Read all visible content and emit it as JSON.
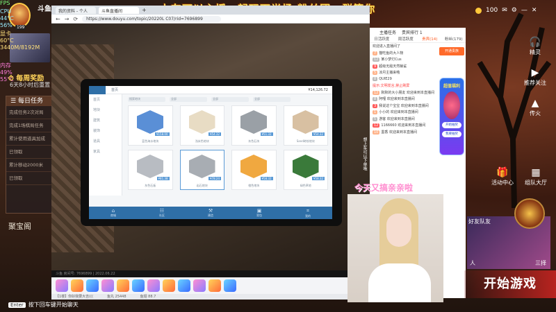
{
  "overlay": {
    "banner": "上车可以主播一起玩下半场  粉丝团一群等你",
    "cam_text": "今天又搞亲亲啦"
  },
  "hud": {
    "top_label": "斗鱼",
    "avatar_level": "199",
    "fps_label": "FPS",
    "cpu_label": "CPU",
    "cpu_temp": "44°C",
    "cpu_usage": "56%",
    "gpu_label": "显卡",
    "gpu_temp": "60°C",
    "gpu_mem": "3440M/8192M",
    "mem_label": "内存",
    "mem_usage": "49%",
    "mem_temp": "55°C",
    "reward": "每周奖励",
    "reward_sub": "6天8小时后重置"
  },
  "tasks": {
    "title": "每日任务",
    "items": [
      "完成任务2次对局",
      "完成1场棋局任务",
      "累计使用道具加成",
      "已领取",
      "累计移动2000米",
      "已领取"
    ],
    "treasure": "聚宝阁"
  },
  "browser": {
    "tabs": [
      "我的资料 - 个人",
      "斗鱼直播间",
      "+"
    ],
    "url": "https://www.douyu.com/topic/20220L C07/rid=7696899",
    "back": "←",
    "forward": "→",
    "refresh": "⟳",
    "player_info": "斗鱼 房间号: 7696899 | 2022.06.22",
    "status_left": "【1楼】你好我要大吉(((",
    "status_mid": "鱼丸 25448",
    "status_mid2": "鱼翅 88.7",
    "send": "发送"
  },
  "tablet": {
    "crumb": "首页",
    "total": "¥14,126.72",
    "side": [
      "首页",
      "地块",
      "建筑",
      "装饰",
      "道具",
      "家具"
    ],
    "filters": [
      "搜索地块",
      "全部",
      "全部",
      "全部"
    ],
    "cards": [
      {
        "price": "¥158.00",
        "name": "蓝色海水地块",
        "color": "#5a8fd6"
      },
      {
        "price": "¥54.32",
        "name": "浅米色地块",
        "color": "#e8dcc4"
      },
      {
        "price": "¥51.32",
        "name": "灰色石块",
        "color": "#9aa0a6"
      },
      {
        "price": "¥54.32",
        "name": "Sand砖纹地块",
        "color": "#d8c0a2"
      },
      {
        "price": "¥81.38",
        "name": "灰色石板",
        "color": "#b8bcc2"
      },
      {
        "price": "¥78.24",
        "name": "岩石地块",
        "color": "#a8adb3"
      },
      {
        "price": "¥58.32",
        "name": "橙色地块",
        "color": "#f0a840"
      },
      {
        "price": "¥58.32",
        "name": "绿色草地",
        "color": "#3a7a3a"
      }
    ],
    "nav": [
      {
        "icon": "⌂",
        "label": "商城"
      },
      {
        "icon": "☷",
        "label": "社区"
      },
      {
        "icon": "⚒",
        "label": "建造"
      },
      {
        "icon": "▣",
        "label": "背包"
      },
      {
        "icon": "⌗",
        "label": "我的"
      }
    ],
    "side_note": "想上车可以下单哦"
  },
  "chat": {
    "header": [
      "主播任务",
      "贵宾排行 1"
    ],
    "tabs": [
      "日活跃度",
      "周活跃度",
      "贵宾(14)",
      "粉丝(179)"
    ],
    "promo": "开通贵族",
    "lines": [
      {
        "lvl": "",
        "text": "欢迎进入直播间了",
        "class": ""
      },
      {
        "lvl": "7",
        "text": "猫吃鱼的大人物",
        "class": ""
      },
      {
        "lvl": "12",
        "text": "某小梦灯Cus",
        "class": ""
      },
      {
        "lvl": "9",
        "text": "超级无敌天然鲸鲨",
        "class": ""
      },
      {
        "lvl": "5",
        "text": "凉月主播来哦",
        "class": ""
      },
      {
        "lvl": "8",
        "text": "QUIE29",
        "class": ""
      },
      {
        "lvl": "",
        "text": "提示:文明发言,禁止刷屏",
        "class": "warn"
      },
      {
        "lvl": "12",
        "text": "默默的大小朋友 欢迎来到本直播间",
        "class": ""
      },
      {
        "lvl": "8",
        "text": "阿哩 欢迎来到本直播间",
        "class": ""
      },
      {
        "lvl": "3",
        "text": "我说这个宝宝 欢迎来到本直播间",
        "class": ""
      },
      {
        "lvl": "1",
        "text": "小小的 欢迎来到本直播间",
        "class": ""
      },
      {
        "lvl": "5",
        "text": "游客 欢迎来到本直播间",
        "class": ""
      },
      {
        "lvl": "12",
        "text": "1166660 欢迎来到本直播间",
        "class": ""
      },
      {
        "lvl": "10",
        "text": "墨香 欢迎来到本直播间",
        "class": ""
      }
    ],
    "popup_title": "超值福利",
    "popup_btn1": "开始抽奖",
    "popup_btn2": "我要抽奖"
  },
  "right": {
    "coins": "100",
    "icons": [
      "✉",
      "⚙",
      "—",
      "✕"
    ],
    "menu": [
      {
        "icon": "🎧",
        "label": "精灵"
      },
      {
        "icon": "▶",
        "label": "推荐关注"
      },
      {
        "icon": "▲",
        "label": "传火"
      },
      {
        "icon": "🎁",
        "label": "活动中心"
      },
      {
        "icon": "▦",
        "label": "组队大厅"
      }
    ],
    "team": "好友队友",
    "hero1": "人",
    "hero2": "三择",
    "start": "开始游戏"
  },
  "bottom": {
    "enter_key": "Enter",
    "hint": "按下回车键开始聊天"
  }
}
